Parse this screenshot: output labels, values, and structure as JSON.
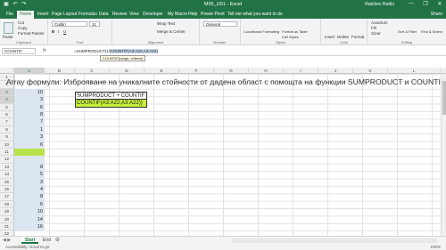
{
  "window": {
    "title": "M05_U01 - Excel",
    "user": "Ratchev Radio",
    "minimize_glyph": "—",
    "restore_glyph": "❐",
    "close_glyph": "✕"
  },
  "ribbon_tabs": [
    "File",
    "Home",
    "Insert",
    "Page Layout",
    "Formulas",
    "Data",
    "Review",
    "View",
    "Developer",
    "My Macro",
    "Help",
    "Power Pivot",
    "Tell me what you want to do"
  ],
  "share_label": "Share",
  "ribbon": {
    "clipboard": {
      "cut": "Cut",
      "copy": "Copy",
      "format_painter": "Format Painter",
      "paste": "Paste",
      "group": "Clipboard"
    },
    "font": {
      "name": "Calibri",
      "size": "11",
      "group": "Font"
    },
    "alignment": {
      "wrap": "Wrap Text",
      "merge": "Merge & Center",
      "group": "Alignment"
    },
    "number": {
      "format": "General",
      "group": "Number"
    },
    "styles": {
      "conditional": "Conditional Formatting",
      "format_as_table": "Format as Table",
      "cell_styles": "Cell Styles",
      "group": "Styles"
    },
    "cells": {
      "insert": "Insert",
      "delete": "Delete",
      "format": "Format",
      "group": "Cells"
    },
    "editing": {
      "autosum": "AutoSum",
      "fill": "Fill",
      "clear": "Clear",
      "sort_filter": "Sort & Filter",
      "find_select": "Find & Select",
      "group": "Editing"
    }
  },
  "formula_bar": {
    "name_box": "COUNTIF",
    "fx": "fx",
    "prefix": "=SUMPRODUCT(1/",
    "highlighted": "COUNTIF(A3:A22,A3:A22)",
    "tooltip": "COUNTIF(range, criteria)"
  },
  "columns": [
    "A",
    "B",
    "C",
    "D",
    "E",
    "F",
    "G",
    "H",
    "I",
    "J",
    "K",
    "L"
  ],
  "rows": [
    "1",
    "2",
    "3",
    "4",
    "5",
    "6",
    "7",
    "8",
    "9",
    "10",
    "11",
    "12",
    "13",
    "14",
    "15",
    "16",
    "17",
    "18",
    "19",
    "20",
    "21",
    "22"
  ],
  "heading": "Array формули: Изброяване на уникалните стойности от дадена област с помощта на функции SUMPRODUCT и COUNTIF",
  "column_a_values": [
    "10",
    "3",
    "6",
    "8",
    "7",
    "1",
    "3",
    "6",
    "",
    "",
    "8",
    "5",
    "3",
    "4",
    "8",
    "6",
    "10",
    "14",
    "16"
  ],
  "box_label": "SUMPRODUCT + COUNTIF",
  "box_formula": "COUNTIF(A3:A22,A3:A22))",
  "sheets": [
    "Start",
    "End"
  ],
  "status": {
    "left": "Accessibility: Good to go",
    "right": "100%"
  }
}
